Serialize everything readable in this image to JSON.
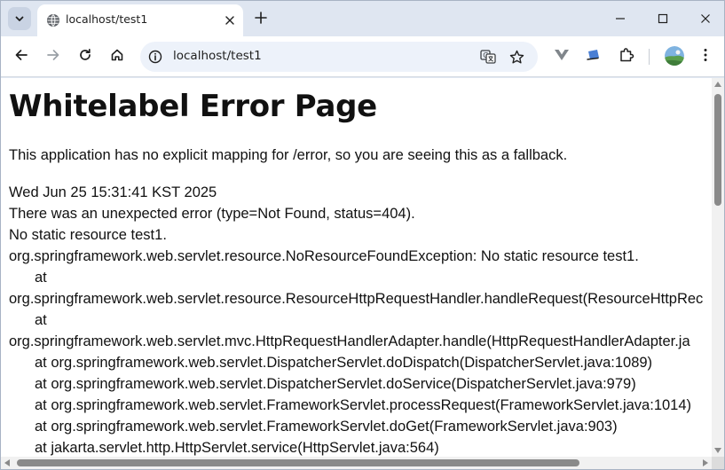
{
  "browser": {
    "tab": {
      "title": "localhost/test1",
      "favicon": "globe-icon"
    },
    "address": {
      "url": "localhost/test1"
    },
    "icons": {
      "tab_search": "chevron-down-icon",
      "new_tab": "plus-icon",
      "minimize": "minimize-icon",
      "maximize": "maximize-icon",
      "close": "close-icon",
      "back": "back-arrow-icon",
      "forward": "forward-arrow-icon",
      "reload": "reload-icon",
      "home": "home-icon",
      "site_info": "site-info-icon",
      "translate": "translate-icon",
      "bookmark": "star-icon",
      "extension_1": "v-extension-icon",
      "extension_2": "reader-extension-icon",
      "extensions": "puzzle-icon",
      "profile": "avatar",
      "menu": "kebab-menu-icon"
    },
    "colors": {
      "frame": "#dfe6f1",
      "omnibox": "#edf2fa",
      "text": "#1f1f1f"
    }
  },
  "page": {
    "heading": "Whitelabel Error Page",
    "description": "This application has no explicit mapping for /error, so you are seeing this as a fallback.",
    "timestamp": "Wed Jun 25 15:31:41 KST 2025",
    "error_summary": "There was an unexpected error (type=Not Found, status=404).",
    "message": "No static resource test1.",
    "trace": [
      "org.springframework.web.servlet.resource.NoResourceFoundException: No static resource test1.",
      "at",
      "org.springframework.web.servlet.resource.ResourceHttpRequestHandler.handleRequest(ResourceHttpRec",
      "at",
      "org.springframework.web.servlet.mvc.HttpRequestHandlerAdapter.handle(HttpRequestHandlerAdapter.ja",
      "at org.springframework.web.servlet.DispatcherServlet.doDispatch(DispatcherServlet.java:1089)",
      "at org.springframework.web.servlet.DispatcherServlet.doService(DispatcherServlet.java:979)",
      "at org.springframework.web.servlet.FrameworkServlet.processRequest(FrameworkServlet.java:1014)",
      "at org.springframework.web.servlet.FrameworkServlet.doGet(FrameworkServlet.java:903)",
      "at jakarta.servlet.http.HttpServlet.service(HttpServlet.java:564)"
    ]
  }
}
